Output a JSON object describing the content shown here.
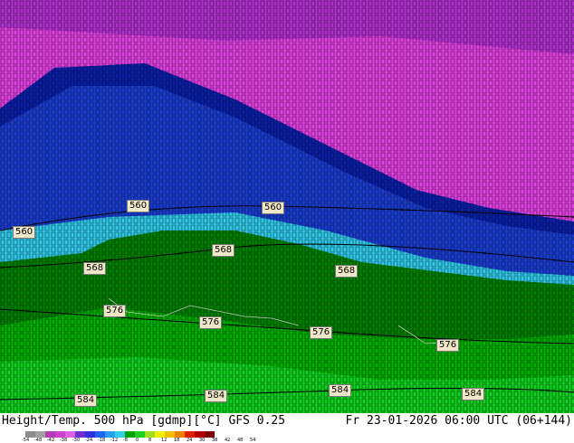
{
  "map": {
    "contour_labels": [
      "560",
      "560",
      "560",
      "568",
      "568",
      "568",
      "576",
      "576",
      "576",
      "576",
      "584",
      "584",
      "584",
      "584"
    ],
    "colors": {
      "magenta": "#e040e0",
      "purple": "#a020c0",
      "blue": "#1a3cd0",
      "deep_blue": "#0a1fa8",
      "cyan": "#30d0e8",
      "dark_green": "#008000",
      "green": "#00b000",
      "bright_green": "#10d020"
    }
  },
  "footer": {
    "left_text": "Height/Temp. 500 hPa [gdmp][°C] GFS 0.25",
    "right_text": "Fr 23-01-2026 06:00 UTC (06+144)"
  },
  "colorbar": {
    "ticks": [
      "-54",
      "-48",
      "-42",
      "-38",
      "-30",
      "-24",
      "-18",
      "-12",
      "-8",
      "0",
      "8",
      "12",
      "18",
      "24",
      "30",
      "38",
      "42",
      "48",
      "54"
    ],
    "colors": [
      "#8c8c8c",
      "#a0a0a0",
      "#b43cb4",
      "#d040d0",
      "#e060e0",
      "#7030d0",
      "#3030e0",
      "#1e64f0",
      "#28a0f0",
      "#30d0e8",
      "#00a000",
      "#20d020",
      "#a0e020",
      "#f0f000",
      "#f0c000",
      "#f08000",
      "#e02000",
      "#b00000",
      "#800000"
    ]
  }
}
